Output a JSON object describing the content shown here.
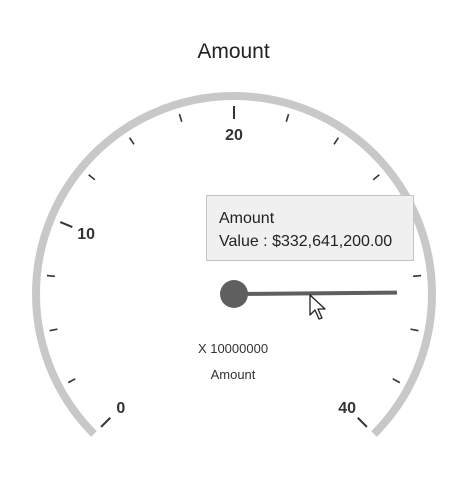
{
  "gauge": {
    "title": "Amount",
    "min": 0,
    "max": 40,
    "major_interval": 10,
    "minor_ticks_per_major": 4,
    "labels": [
      "0",
      "10",
      "20",
      "40"
    ],
    "scale_factor_text": "X 10000000",
    "caption": "Amount",
    "pointer_value": 33.26412,
    "colors": {
      "rim": "#c8c8c8",
      "ticks": "#333333",
      "needle": "#5f5f5f"
    }
  },
  "tooltip": {
    "series_name": "Amount",
    "value_text": "Value : $332,641,200.00"
  },
  "cursor": {
    "icon": "mouse-pointer-icon"
  }
}
